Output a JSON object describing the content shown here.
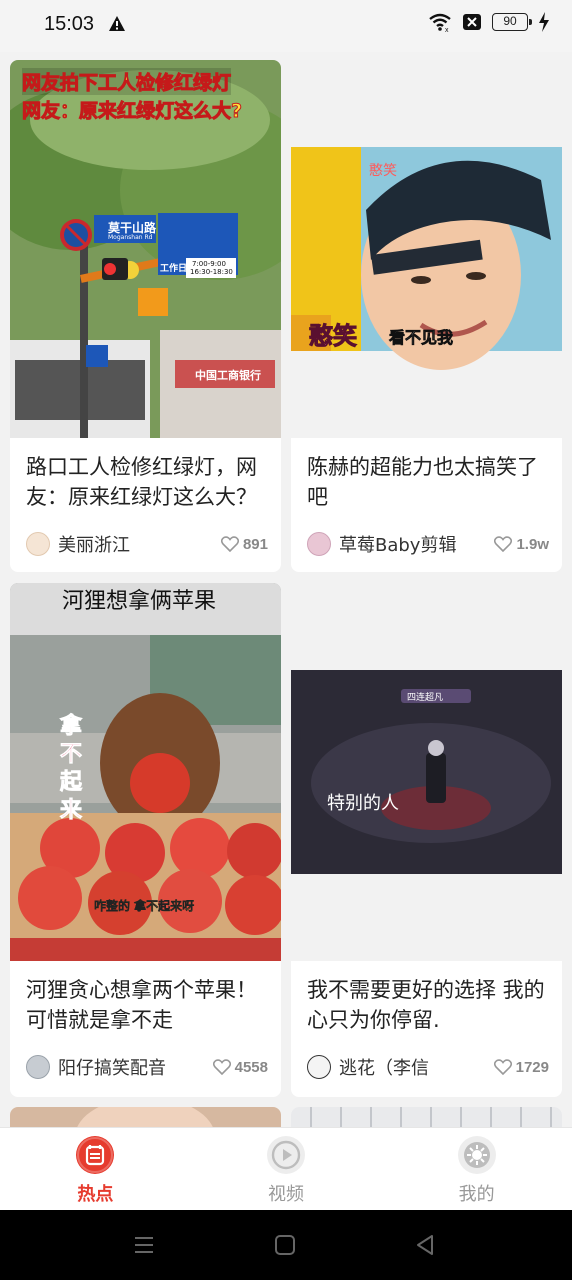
{
  "status": {
    "time": "15:03",
    "battery": "90"
  },
  "feed": {
    "cards": [
      {
        "title": "路口工人检修红绿灯，网友：原来红绿灯这么大？",
        "author": "美丽浙江",
        "likes": "891",
        "overlay": [
          "网友拍下工人检修红绿灯",
          "网友：原来红绿灯这么大?"
        ],
        "sign": [
          "莫干山路",
          "Moganshan Rd",
          "工作日",
          "7:00-9:00",
          "16:30-18:30"
        ],
        "bank": "中国工商银行"
      },
      {
        "title": "陈赫的超能力也太搞笑了吧",
        "author": "草莓Baby剪辑",
        "likes": "1.9w",
        "overlay": [
          "憨笑",
          "憨笑",
          "看不见我"
        ]
      },
      {
        "title": "河狸贪心想拿两个苹果！可惜就是拿不走",
        "author": "阳仔搞笑配音",
        "likes": "4558",
        "overlay": [
          "河狸想拿俩苹果",
          "拿不起来",
          "咋整的 拿不起来呀"
        ]
      },
      {
        "title": "我不需要更好的选择 我的心只为你停留.",
        "author": "逃花（李信",
        "likes": "1729",
        "overlay": [
          "特别的人",
          "四连超凡"
        ]
      }
    ]
  },
  "tabs": [
    {
      "label": "热点",
      "icon": "hot-icon",
      "active": true
    },
    {
      "label": "视频",
      "icon": "play-icon",
      "active": false
    },
    {
      "label": "我的",
      "icon": "profile-icon",
      "active": false
    }
  ],
  "colors": {
    "accent": "#e63b2e",
    "inactive": "#999999"
  }
}
